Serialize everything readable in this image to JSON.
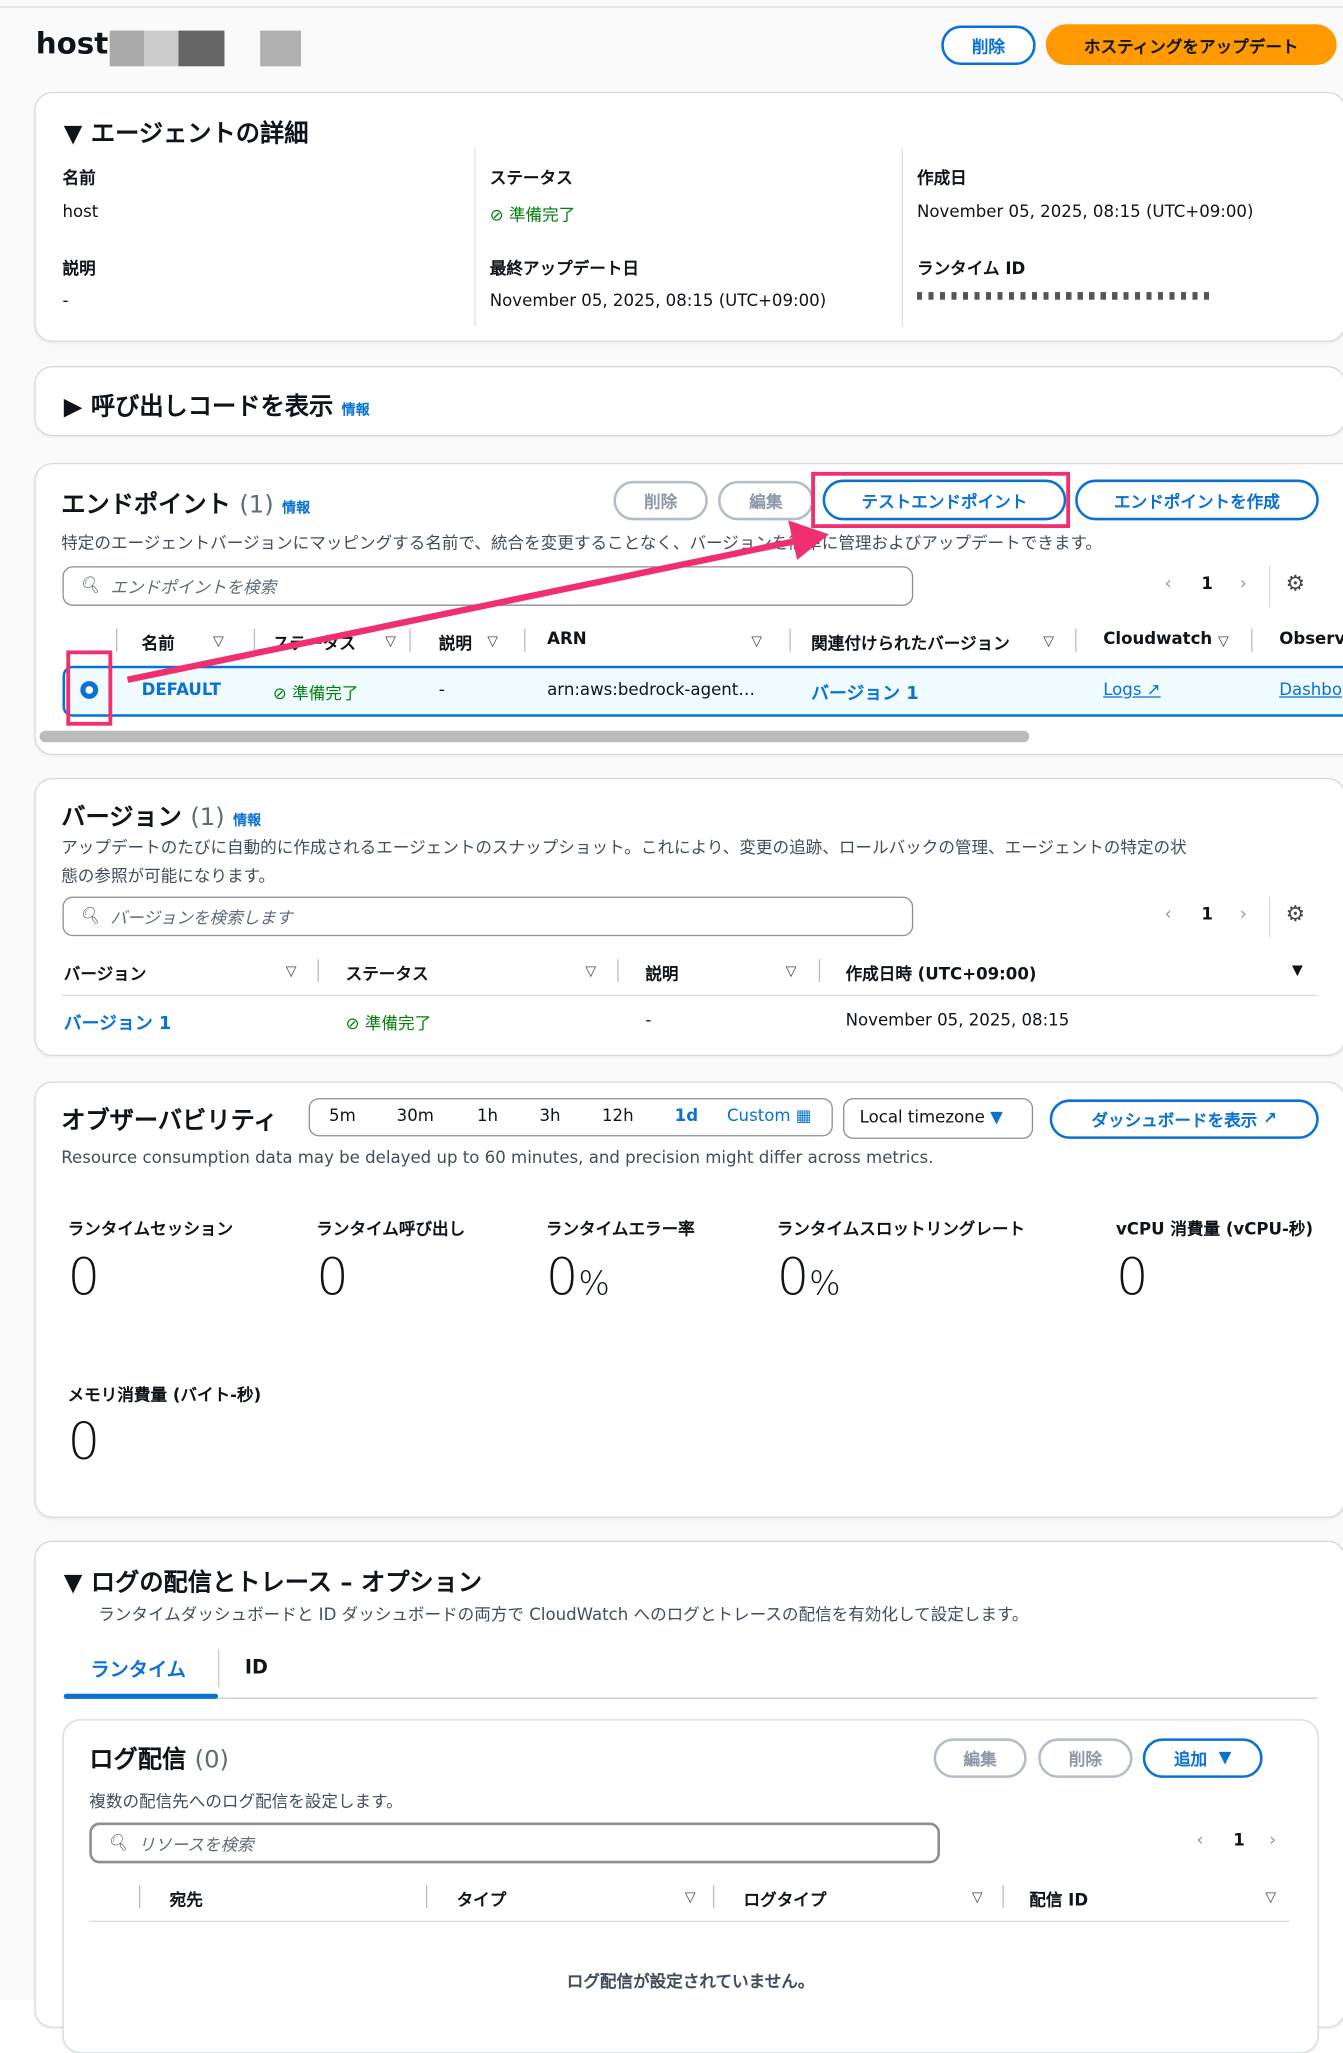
{
  "header": {
    "title": "host",
    "delete_label": "削除",
    "update_label": "ホスティングをアップデート"
  },
  "details": {
    "heading": "エージェントの詳細",
    "name_label": "名前",
    "name_value": "host",
    "status_label": "ステータス",
    "status_value": "準備完了",
    "created_label": "作成日",
    "created_value": "November 05, 2025, 08:15 (UTC+09:00)",
    "description_label": "説明",
    "description_value": "-",
    "updated_label": "最終アップデート日",
    "updated_value": "November 05, 2025, 08:15 (UTC+09:00)",
    "runtime_id_label": "ランタイム ID"
  },
  "invoke_code": {
    "heading": "呼び出しコードを表示",
    "info": "情報"
  },
  "endpoints": {
    "heading": "エンドポイント",
    "count": "(1)",
    "info": "情報",
    "delete_label": "削除",
    "edit_label": "編集",
    "test_label": "テストエンドポイント",
    "create_label": "エンドポイントを作成",
    "description": "特定のエージェントバージョンにマッピングする名前で、統合を変更することなく、バージョンを簡単に管理およびアップデートできます。",
    "search_placeholder": "エンドポイントを検索",
    "page": "1",
    "columns": [
      "名前",
      "ステータス",
      "説明",
      "ARN",
      "関連付けられたバージョン",
      "Cloudwatch",
      "Observa"
    ],
    "rows": [
      {
        "name": "DEFAULT",
        "status": "準備完了",
        "description": "-",
        "arn": "arn:aws:bedrock-agent…",
        "version": "バージョン 1",
        "cloudwatch": "Logs",
        "observability": "Dashbo",
        "selected": true
      }
    ]
  },
  "versions": {
    "heading": "バージョン",
    "count": "(1)",
    "info": "情報",
    "description_1": "アップデートのたびに自動的に作成されるエージェントのスナップショット。これにより、変更の追跡、ロールバックの管理、エージェントの特定の状",
    "description_2": "態の参照が可能になります。",
    "search_placeholder": "バージョンを検索します",
    "page": "1",
    "columns": [
      "バージョン",
      "ステータス",
      "説明",
      "作成日時 (UTC+09:00)"
    ],
    "rows": [
      {
        "version": "バージョン 1",
        "status": "準備完了",
        "description": "-",
        "created": "November 05, 2025, 08:15"
      }
    ]
  },
  "observability": {
    "heading": "オブザーバビリティ",
    "ranges": [
      "5m",
      "30m",
      "1h",
      "3h",
      "12h",
      "1d"
    ],
    "selected_range": "1d",
    "custom_label": "Custom",
    "timezone": "Local timezone",
    "dashboard_label": "ダッシュボードを表示",
    "note": "Resource consumption data may be delayed up to 60 minutes, and precision might differ across metrics.",
    "metrics": [
      {
        "label": "ランタイムセッション",
        "value": "0",
        "unit": ""
      },
      {
        "label": "ランタイム呼び出し",
        "value": "0",
        "unit": ""
      },
      {
        "label": "ランタイムエラー率",
        "value": "0",
        "unit": "%"
      },
      {
        "label": "ランタイムスロットリングレート",
        "value": "0",
        "unit": "%"
      },
      {
        "label": "vCPU 消費量 (vCPU-秒)",
        "value": "0",
        "unit": ""
      },
      {
        "label": "メモリ消費量 (バイト-秒)",
        "value": "0",
        "unit": ""
      }
    ]
  },
  "logs": {
    "heading": "ログの配信とトレース – オプション",
    "description": "ランタイムダッシュボードと ID ダッシュボードの両方で CloudWatch へのログとトレースの配信を有効化して設定します。",
    "tabs": [
      "ランタイム",
      "ID"
    ],
    "delivery": {
      "heading": "ログ配信",
      "count": "(0)",
      "edit_label": "編集",
      "delete_label": "削除",
      "add_label": "追加",
      "description": "複数の配信先へのログ配信を設定します。",
      "search_placeholder": "リソースを検索",
      "page": "1",
      "columns": [
        "宛先",
        "タイプ",
        "ログタイプ",
        "配信 ID"
      ],
      "empty": "ログ配信が設定されていません。"
    }
  },
  "colors": {
    "primary": "#0972d3",
    "orange": "#ff9900",
    "success": "#037f0c",
    "annotation": "#f0306e"
  }
}
